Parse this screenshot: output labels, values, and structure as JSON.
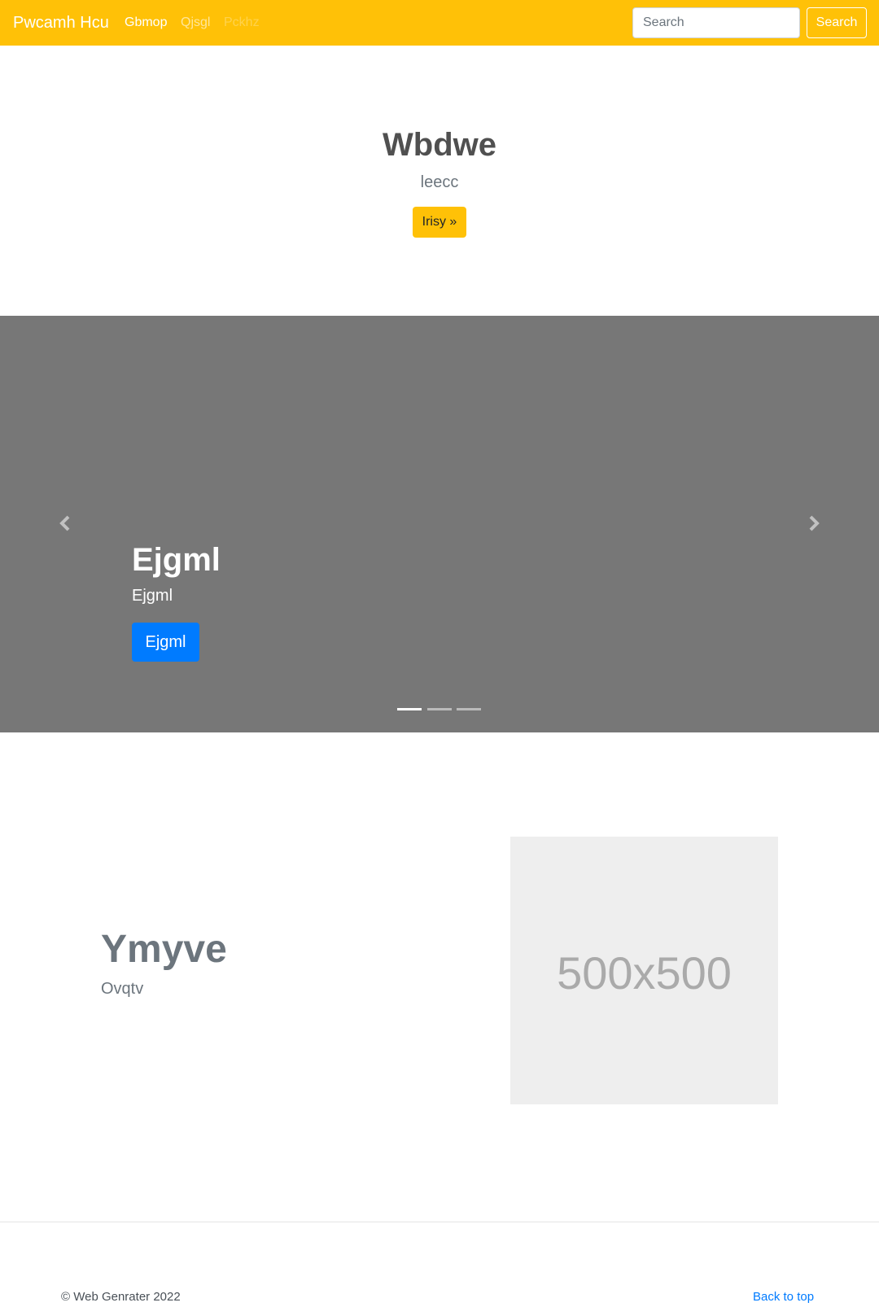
{
  "navbar": {
    "brand": "Pwcamh Hcu",
    "links": [
      "Gbmop",
      "Qjsgl",
      "Pckhz"
    ],
    "search_placeholder": "Search",
    "search_button": "Search",
    "background": "#ffc107"
  },
  "jumbotron": {
    "title": "Wbdwe",
    "subtitle": "leecc",
    "button": "Irisy »"
  },
  "carousel": {
    "background": "#777777",
    "prev_icon": "chevron-left-icon",
    "next_icon": "chevron-right-icon",
    "slide": {
      "title": "Ejgml",
      "text": "Ejgml",
      "button": "Ejgml"
    },
    "indicators_count": 3,
    "active_index": 0
  },
  "feature": {
    "title": "Ymyve",
    "subtitle": "Ovqtv",
    "image_label": "500x500"
  },
  "footer": {
    "copyright": "© Web Genrater 2022",
    "back_to_top": "Back to top"
  },
  "colors": {
    "accent": "#ffc107",
    "primary": "#007bff"
  }
}
